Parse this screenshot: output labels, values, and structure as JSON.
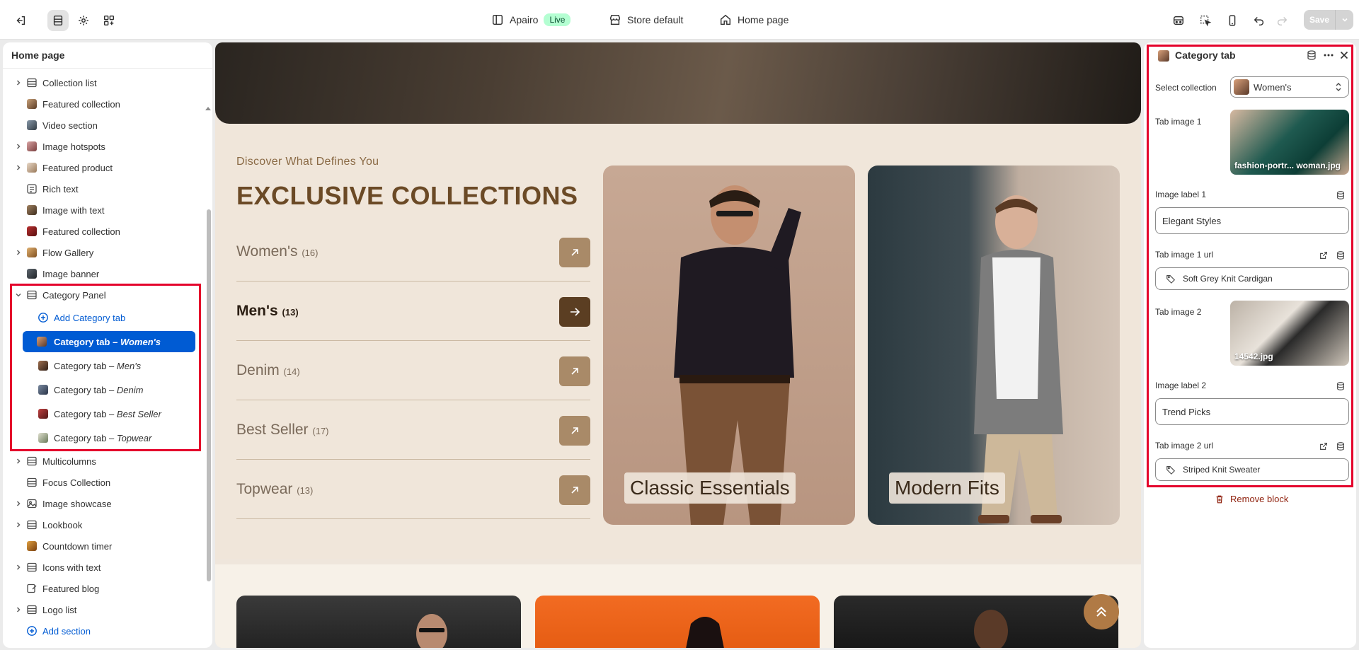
{
  "topbar": {
    "store_name": "Apairo",
    "live_label": "Live",
    "theme": "Store default",
    "page": "Home page",
    "save_label": "Save"
  },
  "sidebar": {
    "title": "Home page",
    "items": [
      {
        "label": "Collection list",
        "expandable": true
      },
      {
        "label": "Featured collection",
        "expandable": false
      },
      {
        "label": "Video section",
        "expandable": false
      },
      {
        "label": "Image hotspots",
        "expandable": true
      },
      {
        "label": "Featured product",
        "expandable": true
      },
      {
        "label": "Rich text",
        "expandable": false
      },
      {
        "label": "Image with text",
        "expandable": false
      },
      {
        "label": "Featured collection",
        "expandable": false
      },
      {
        "label": "Flow Gallery",
        "expandable": true
      },
      {
        "label": "Image banner",
        "expandable": false
      },
      {
        "label": "Category Panel",
        "expandable": true
      }
    ],
    "category_panel": {
      "add_label": "Add Category tab",
      "tab_prefix": "Category tab –",
      "tabs": [
        "Women's",
        "Men's",
        "Denim",
        "Best Seller",
        "Topwear"
      ]
    },
    "items_after": [
      {
        "label": "Multicolumns",
        "expandable": true
      },
      {
        "label": "Focus Collection",
        "expandable": false
      },
      {
        "label": "Image showcase",
        "expandable": true
      },
      {
        "label": "Lookbook",
        "expandable": true
      },
      {
        "label": "Countdown timer",
        "expandable": false
      },
      {
        "label": "Icons with text",
        "expandable": true
      },
      {
        "label": "Featured blog",
        "expandable": false
      },
      {
        "label": "Logo list",
        "expandable": true
      }
    ],
    "add_section_label": "Add section"
  },
  "preview": {
    "eyebrow": "Discover What Defines You",
    "title": "EXCLUSIVE COLLECTIONS",
    "categories": [
      {
        "name": "Women's",
        "count": "(16)",
        "active": false
      },
      {
        "name": "Men's",
        "count": "(13)",
        "active": true
      },
      {
        "name": "Denim",
        "count": "(14)",
        "active": false
      },
      {
        "name": "Best Seller",
        "count": "(17)",
        "active": false
      },
      {
        "name": "Topwear",
        "count": "(13)",
        "active": false
      }
    ],
    "photo_labels": [
      "Classic Essentials",
      "Modern Fits"
    ]
  },
  "panel": {
    "title": "Category tab",
    "select_collection_label": "Select collection",
    "select_collection_value": "Women's",
    "tab_image_1_label": "Tab image 1",
    "tab_image_1_file": "fashion-portr... woman.jpg",
    "image_label_1_label": "Image label 1",
    "image_label_1_value": "Elegant Styles",
    "tab_image_1_url_label": "Tab image 1 url",
    "tab_image_1_url_value": "Soft Grey Knit Cardigan",
    "tab_image_2_label": "Tab image 2",
    "tab_image_2_file": "14542.jpg",
    "image_label_2_label": "Image label 2",
    "image_label_2_value": "Trend Picks",
    "tab_image_2_url_label": "Tab image 2 url",
    "tab_image_2_url_value": "Striped Knit Sweater",
    "remove_label": "Remove block"
  },
  "colors": {
    "accent": "#005bd3",
    "highlight": "#e4002b",
    "brand_brown": "#6b4a26"
  }
}
